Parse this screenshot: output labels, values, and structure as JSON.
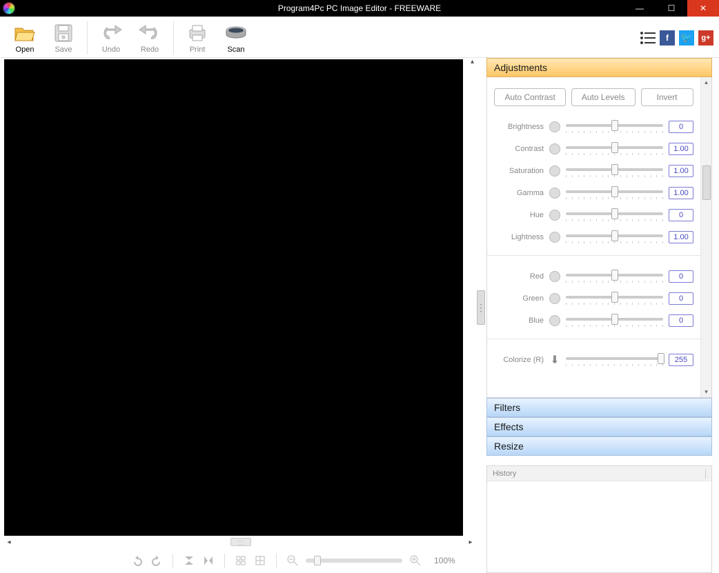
{
  "title": "Program4Pc PC Image Editor - FREEWARE",
  "toolbar": {
    "open": "Open",
    "save": "Save",
    "undo": "Undo",
    "redo": "Redo",
    "print": "Print",
    "scan": "Scan"
  },
  "social": {
    "fb": "f",
    "tw": "🐦",
    "gp": "g+"
  },
  "zoom": {
    "label": "100%"
  },
  "panel": {
    "adjustments": "Adjustments",
    "filters": "Filters",
    "effects": "Effects",
    "resize": "Resize",
    "history": "History",
    "buttons": {
      "auto_contrast": "Auto Contrast",
      "auto_levels": "Auto Levels",
      "invert": "Invert"
    },
    "sliders": [
      {
        "label": "Brightness",
        "value": "0",
        "pos": 50
      },
      {
        "label": "Contrast",
        "value": "1.00",
        "pos": 50
      },
      {
        "label": "Saturation",
        "value": "1.00",
        "pos": 50
      },
      {
        "label": "Gamma",
        "value": "1.00",
        "pos": 50
      },
      {
        "label": "Hue",
        "value": "0",
        "pos": 50
      },
      {
        "label": "Lightness",
        "value": "1.00",
        "pos": 50
      }
    ],
    "rgb": [
      {
        "label": "Red",
        "value": "0",
        "pos": 50
      },
      {
        "label": "Green",
        "value": "0",
        "pos": 50
      },
      {
        "label": "Blue",
        "value": "0",
        "pos": 50
      }
    ],
    "colorize": {
      "label": "Colorize (R)",
      "value": "255",
      "pos": 98
    }
  }
}
